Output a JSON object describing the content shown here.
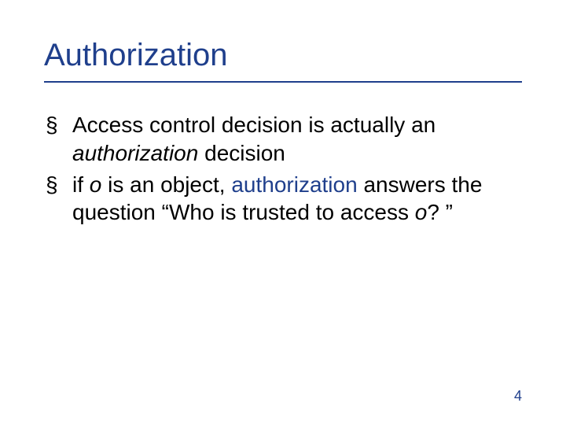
{
  "title": "Authorization",
  "bullets": [
    {
      "pre1": "Access control decision is actually an ",
      "it1": "authorization",
      "post1": " decision"
    },
    {
      "pre1": "if ",
      "it1": "o",
      "mid1": " is an object, ",
      "kw1": "authorization",
      "mid2": " answers the question “Who is trusted to access ",
      "it2": "o",
      "post2": "? ”"
    }
  ],
  "page_number": "4"
}
